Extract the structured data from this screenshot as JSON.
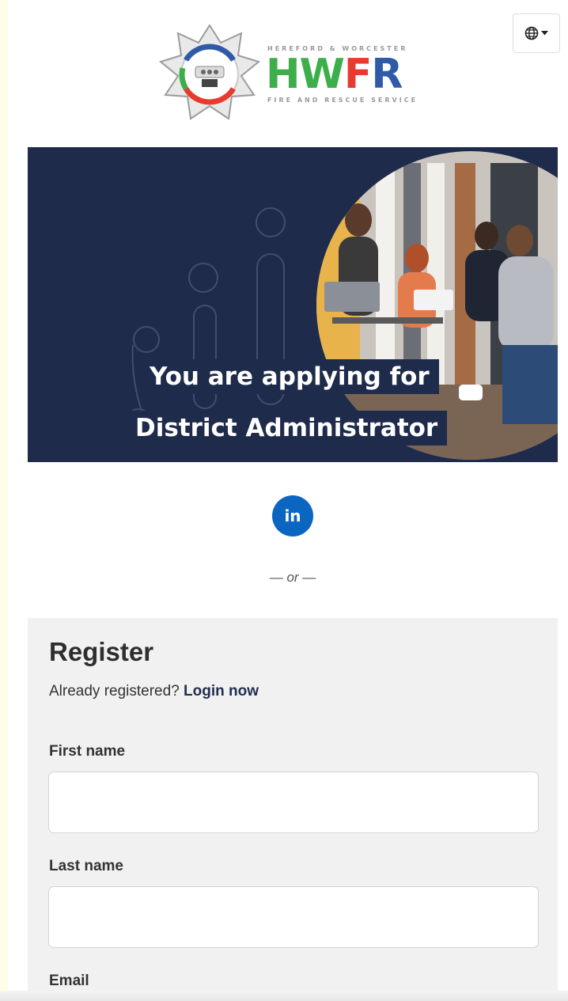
{
  "header": {
    "language_icon": "globe-icon",
    "language_caret_icon": "caret-down-icon",
    "logo": {
      "top_text": "HEREFORD & WORCESTER",
      "main_text": "HWFR",
      "bottom_text": "FIRE AND RESCUE SERVICE",
      "colors": {
        "green": "#3dae49",
        "red": "#e63b2e",
        "blue": "#2f5aa8"
      }
    }
  },
  "banner": {
    "line1": "You are applying for",
    "line2": "District Administrator",
    "background": "#1e2b4a"
  },
  "social": {
    "linkedin_label": "in",
    "linkedin_color": "#0b66c2",
    "separator": "— or —"
  },
  "register": {
    "title": "Register",
    "already_text": "Already registered?",
    "login_link": "Login now",
    "fields": {
      "first_name": {
        "label": "First name",
        "value": ""
      },
      "last_name": {
        "label": "Last name",
        "value": ""
      },
      "email": {
        "label": "Email"
      }
    }
  }
}
